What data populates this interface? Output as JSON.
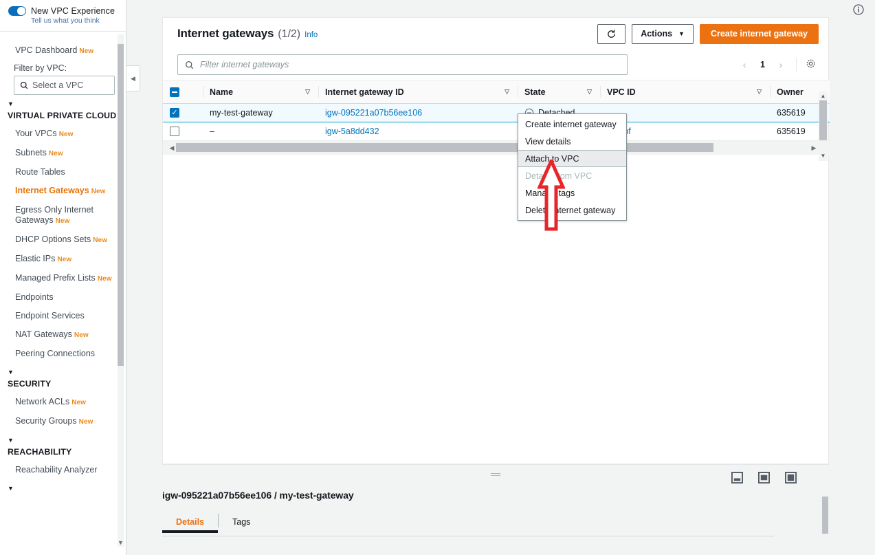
{
  "sidebar": {
    "experience": {
      "title": "New VPC Experience",
      "subtitle": "Tell us what you think",
      "toggle_on": true
    },
    "dashboard": {
      "label": "VPC Dashboard",
      "badge": "New"
    },
    "filter_label": "Filter by VPC:",
    "vpc_select_placeholder": "Select a VPC",
    "sections": [
      {
        "title": "VIRTUAL PRIVATE CLOUD",
        "items": [
          {
            "label": "Your VPCs",
            "badge": "New",
            "active": false
          },
          {
            "label": "Subnets",
            "badge": "New",
            "active": false
          },
          {
            "label": "Route Tables",
            "badge": "",
            "active": false
          },
          {
            "label": "Internet Gateways",
            "badge": "New",
            "active": true
          },
          {
            "label": "Egress Only Internet Gateways",
            "badge": "New",
            "active": false
          },
          {
            "label": "DHCP Options Sets",
            "badge": "New",
            "active": false
          },
          {
            "label": "Elastic IPs",
            "badge": "New",
            "active": false
          },
          {
            "label": "Managed Prefix Lists",
            "badge": "New",
            "active": false
          },
          {
            "label": "Endpoints",
            "badge": "",
            "active": false
          },
          {
            "label": "Endpoint Services",
            "badge": "",
            "active": false
          },
          {
            "label": "NAT Gateways",
            "badge": "New",
            "active": false
          },
          {
            "label": "Peering Connections",
            "badge": "",
            "active": false
          }
        ]
      },
      {
        "title": "SECURITY",
        "items": [
          {
            "label": "Network ACLs",
            "badge": "New",
            "active": false
          },
          {
            "label": "Security Groups",
            "badge": "New",
            "active": false
          }
        ]
      },
      {
        "title": "REACHABILITY",
        "items": [
          {
            "label": "Reachability Analyzer",
            "badge": "",
            "active": false
          }
        ]
      }
    ]
  },
  "header": {
    "title": "Internet gateways",
    "count": "(1/2)",
    "info_label": "Info",
    "refresh_label": "↻",
    "actions_label": "Actions",
    "create_label": "Create internet gateway",
    "primary_color": "#ec7211"
  },
  "filter": {
    "placeholder": "Filter internet gateways",
    "page_number": "1"
  },
  "table": {
    "columns": [
      {
        "label": "",
        "sortable": false
      },
      {
        "label": "Name",
        "sortable": true
      },
      {
        "label": "Internet gateway ID",
        "sortable": true
      },
      {
        "label": "State",
        "sortable": true
      },
      {
        "label": "VPC ID",
        "sortable": true
      },
      {
        "label": "Owner",
        "sortable": false
      }
    ],
    "rows": [
      {
        "selected": true,
        "name": "my-test-gateway",
        "igw_id": "igw-095221a07b56ee106",
        "state": "Detached",
        "state_icon": "circle-minus-icon",
        "vpc_id": "",
        "owner": "635619"
      },
      {
        "selected": false,
        "name": "–",
        "igw_id": "igw-5a8dd432",
        "state": "",
        "state_icon": "circle-check-icon",
        "vpc_id": "e05fbf",
        "owner": "635619"
      }
    ]
  },
  "context_menu": {
    "items": [
      {
        "label": "Create internet gateway",
        "state": "normal"
      },
      {
        "label": "View details",
        "state": "normal"
      },
      {
        "label": "Attach to VPC",
        "state": "hover"
      },
      {
        "label": "Detach from VPC",
        "state": "disabled"
      },
      {
        "label": "Manage tags",
        "state": "normal"
      },
      {
        "label": "Delete internet gateway",
        "state": "normal"
      }
    ]
  },
  "annotation": {
    "arrow_color": "#e8262a",
    "points_to": "Attach to VPC"
  },
  "detail_panel": {
    "title": "igw-095221a07b56ee106 / my-test-gateway",
    "tabs": [
      {
        "label": "Details",
        "active": true
      },
      {
        "label": "Tags",
        "active": false
      }
    ]
  }
}
